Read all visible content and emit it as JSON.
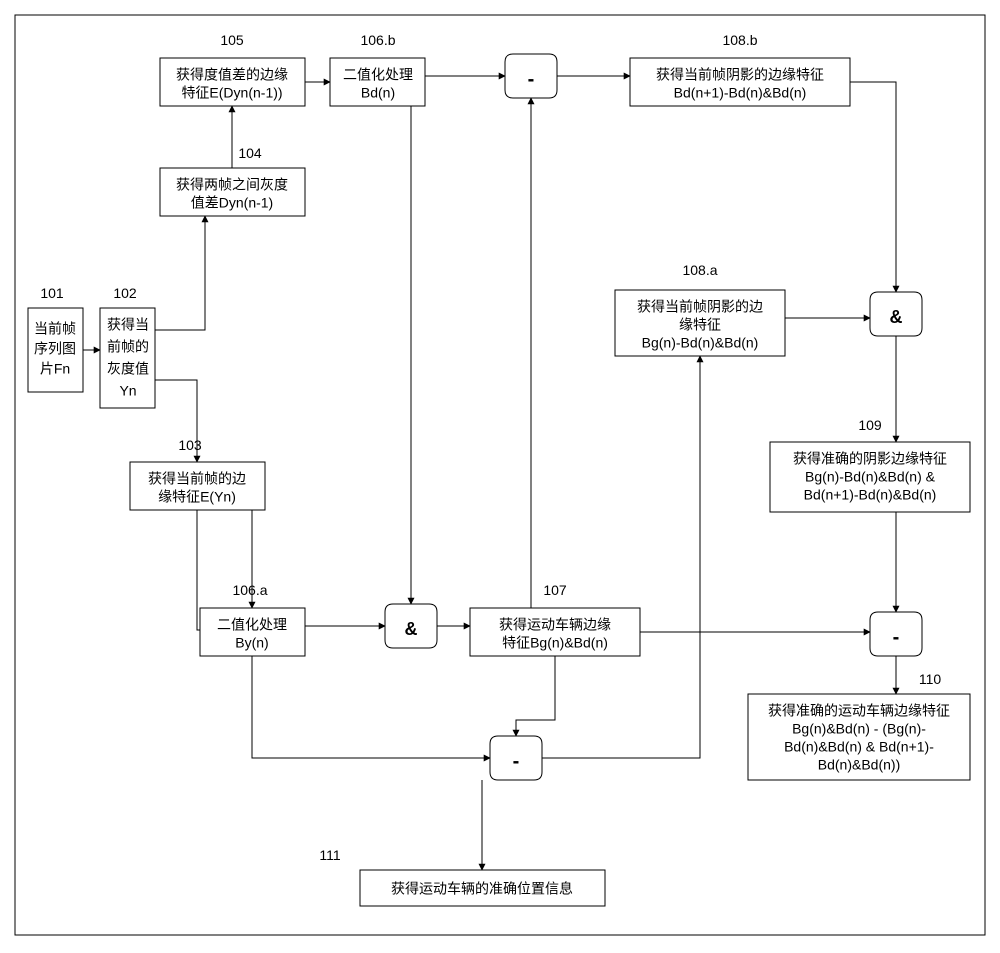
{
  "chart_data": {
    "type": "diagram",
    "title": "",
    "nodes": [
      {
        "id": "101",
        "label": "101",
        "lines": [
          "当前帧",
          "序列图",
          "片Fn"
        ]
      },
      {
        "id": "102",
        "label": "102",
        "lines": [
          "获得当",
          "前帧的",
          "灰度值",
          "Yn"
        ]
      },
      {
        "id": "103",
        "label": "103",
        "lines": [
          "获得当前帧的边",
          "缘特征E(Yn)"
        ]
      },
      {
        "id": "104",
        "label": "104",
        "lines": [
          "获得两帧之间灰度",
          "值差Dyn(n-1)"
        ]
      },
      {
        "id": "105",
        "label": "105",
        "lines": [
          "获得度值差的边缘",
          "特征E(Dyn(n-1))"
        ]
      },
      {
        "id": "106a",
        "label": "106.a",
        "lines": [
          "二值化处理",
          "By(n)"
        ]
      },
      {
        "id": "106b",
        "label": "106.b",
        "lines": [
          "二值化处理",
          "Bd(n)"
        ]
      },
      {
        "id": "107",
        "label": "107",
        "lines": [
          "获得运动车辆边缘",
          "特征Bg(n)&Bd(n)"
        ]
      },
      {
        "id": "108a",
        "label": "108.a",
        "lines": [
          "获得当前帧阴影的边",
          "缘特征",
          "Bg(n)-Bd(n)&Bd(n)"
        ]
      },
      {
        "id": "108b",
        "label": "108.b",
        "lines": [
          "获得当前帧阴影的边缘特征",
          "Bd(n+1)-Bd(n)&Bd(n)"
        ]
      },
      {
        "id": "109",
        "label": "109",
        "lines": [
          "获得准确的阴影边缘特征",
          "Bg(n)-Bd(n)&Bd(n) &",
          "Bd(n+1)-Bd(n)&Bd(n)"
        ]
      },
      {
        "id": "110",
        "label": "110",
        "lines": [
          "获得准确的运动车辆边缘特征",
          "Bg(n)&Bd(n) - (Bg(n)-",
          "Bd(n)&Bd(n) & Bd(n+1)-",
          "Bd(n)&Bd(n))"
        ]
      },
      {
        "id": "111",
        "label": "111",
        "lines": [
          "获得运动车辆的准确位置信息"
        ]
      }
    ],
    "ops": [
      {
        "id": "minus1",
        "symbol": "-"
      },
      {
        "id": "and1",
        "symbol": "&"
      },
      {
        "id": "and2",
        "symbol": "&"
      },
      {
        "id": "minus2",
        "symbol": "-"
      },
      {
        "id": "minus3",
        "symbol": "-"
      }
    ]
  }
}
